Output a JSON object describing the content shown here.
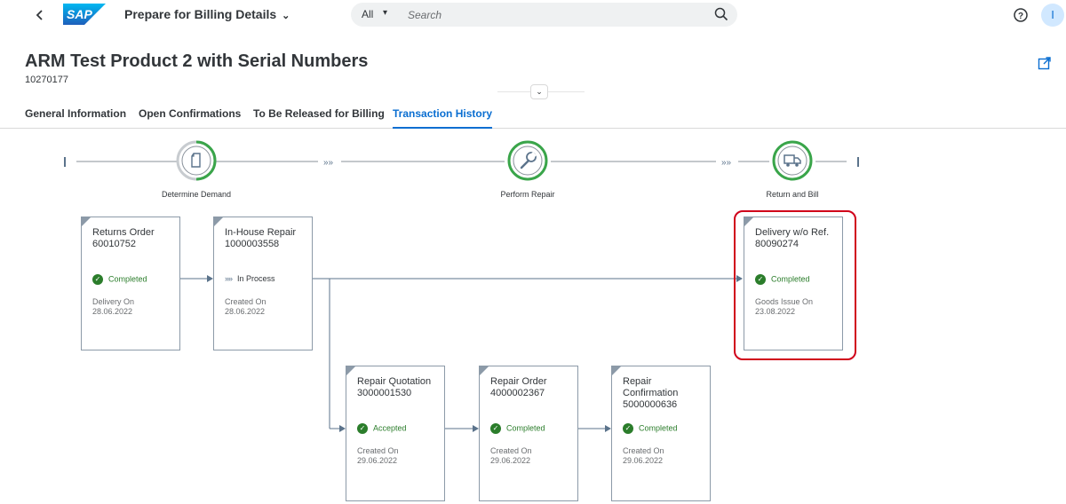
{
  "shell": {
    "app_title": "Prepare for Billing Details",
    "search_scope": "All",
    "search_placeholder": "Search",
    "avatar_initial": "I",
    "brand_color": "#0a6ed1"
  },
  "header": {
    "title": "ARM Test Product 2 with Serial Numbers",
    "subtitle": "10270177"
  },
  "tabs": [
    {
      "label": "General Information",
      "active": false
    },
    {
      "label": "Open Confirmations",
      "active": false
    },
    {
      "label": "To Be Released for Billing",
      "active": false
    },
    {
      "label": "Transaction History",
      "active": true
    }
  ],
  "phases": [
    {
      "label": "Determine Demand",
      "icon": "document-icon"
    },
    {
      "label": "Perform Repair",
      "icon": "wrench-icon"
    },
    {
      "label": "Return and Bill",
      "icon": "truck-icon"
    }
  ],
  "cards": [
    {
      "title": "Returns Order",
      "number": "60010752",
      "status": "Completed",
      "status_type": "success",
      "date_label": "Delivery On",
      "date": "28.06.2022"
    },
    {
      "title": "In-House Repair",
      "number": "1000003558",
      "status": "In Process",
      "status_type": "process",
      "date_label": "Created On",
      "date": "28.06.2022"
    },
    {
      "title": "Delivery w/o Ref.",
      "number": "80090274",
      "status": "Completed",
      "status_type": "success",
      "date_label": "Goods Issue On",
      "date": "23.08.2022"
    },
    {
      "title": "Repair Quotation",
      "number": "3000001530",
      "status": "Accepted",
      "status_type": "success",
      "date_label": "Created On",
      "date": "29.06.2022"
    },
    {
      "title": "Repair Order",
      "number": "4000002367",
      "status": "Completed",
      "status_type": "success",
      "date_label": "Created On",
      "date": "29.06.2022"
    },
    {
      "title": "Repair Confirmation",
      "number": "5000000636",
      "status": "Completed",
      "status_type": "success",
      "date_label": "Created On",
      "date": "29.06.2022"
    }
  ],
  "colors": {
    "success": "#2b7d2b",
    "highlight": "#d0001a",
    "phase_ring": "#3aa54a"
  }
}
